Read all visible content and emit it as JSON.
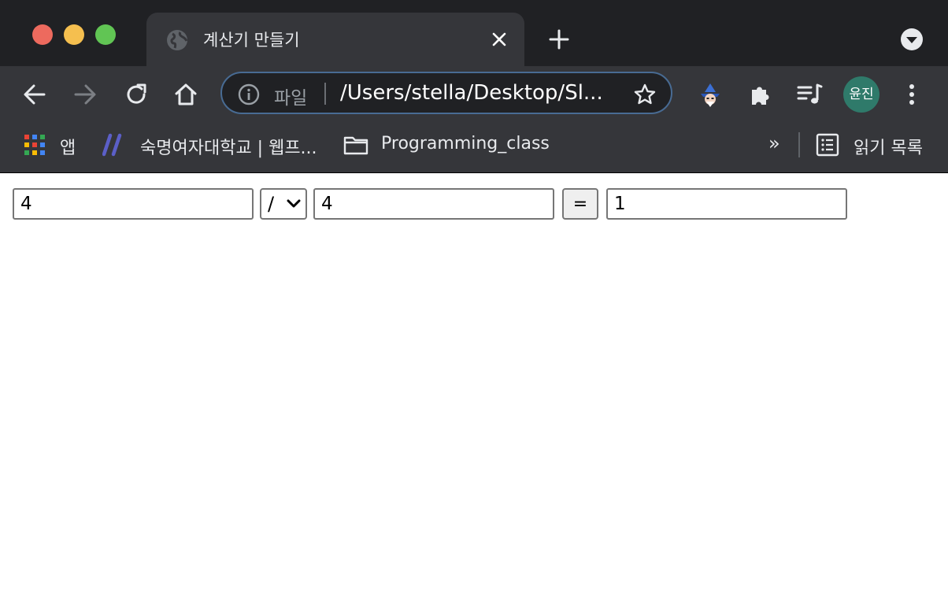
{
  "tab": {
    "title": "계산기 만들기"
  },
  "omnibox": {
    "scheme_label": "파일",
    "url": "/Users/stella/Desktop/Sl..."
  },
  "profile": {
    "initials": "윤진"
  },
  "bookmarks": {
    "apps_label": "앱",
    "items": [
      {
        "label": "숙명여자대학교 | 웹프...",
        "icon": "slash-logo-icon"
      },
      {
        "label": "Programming_class",
        "icon": "folder-icon"
      }
    ],
    "overflow_label": "»",
    "reading_list_label": "읽기 목록"
  },
  "calculator": {
    "operand1": "4",
    "operator": "/",
    "operand2": "4",
    "equals_label": "=",
    "result": "1"
  },
  "colors": {
    "titlebar": "#202124",
    "toolbar": "#35363a",
    "omnibox_border": "#486b93",
    "avatar": "#2f7a6a",
    "traffic_close": "#ed6a5e",
    "traffic_min": "#f5bf4f",
    "traffic_max": "#61c554"
  }
}
